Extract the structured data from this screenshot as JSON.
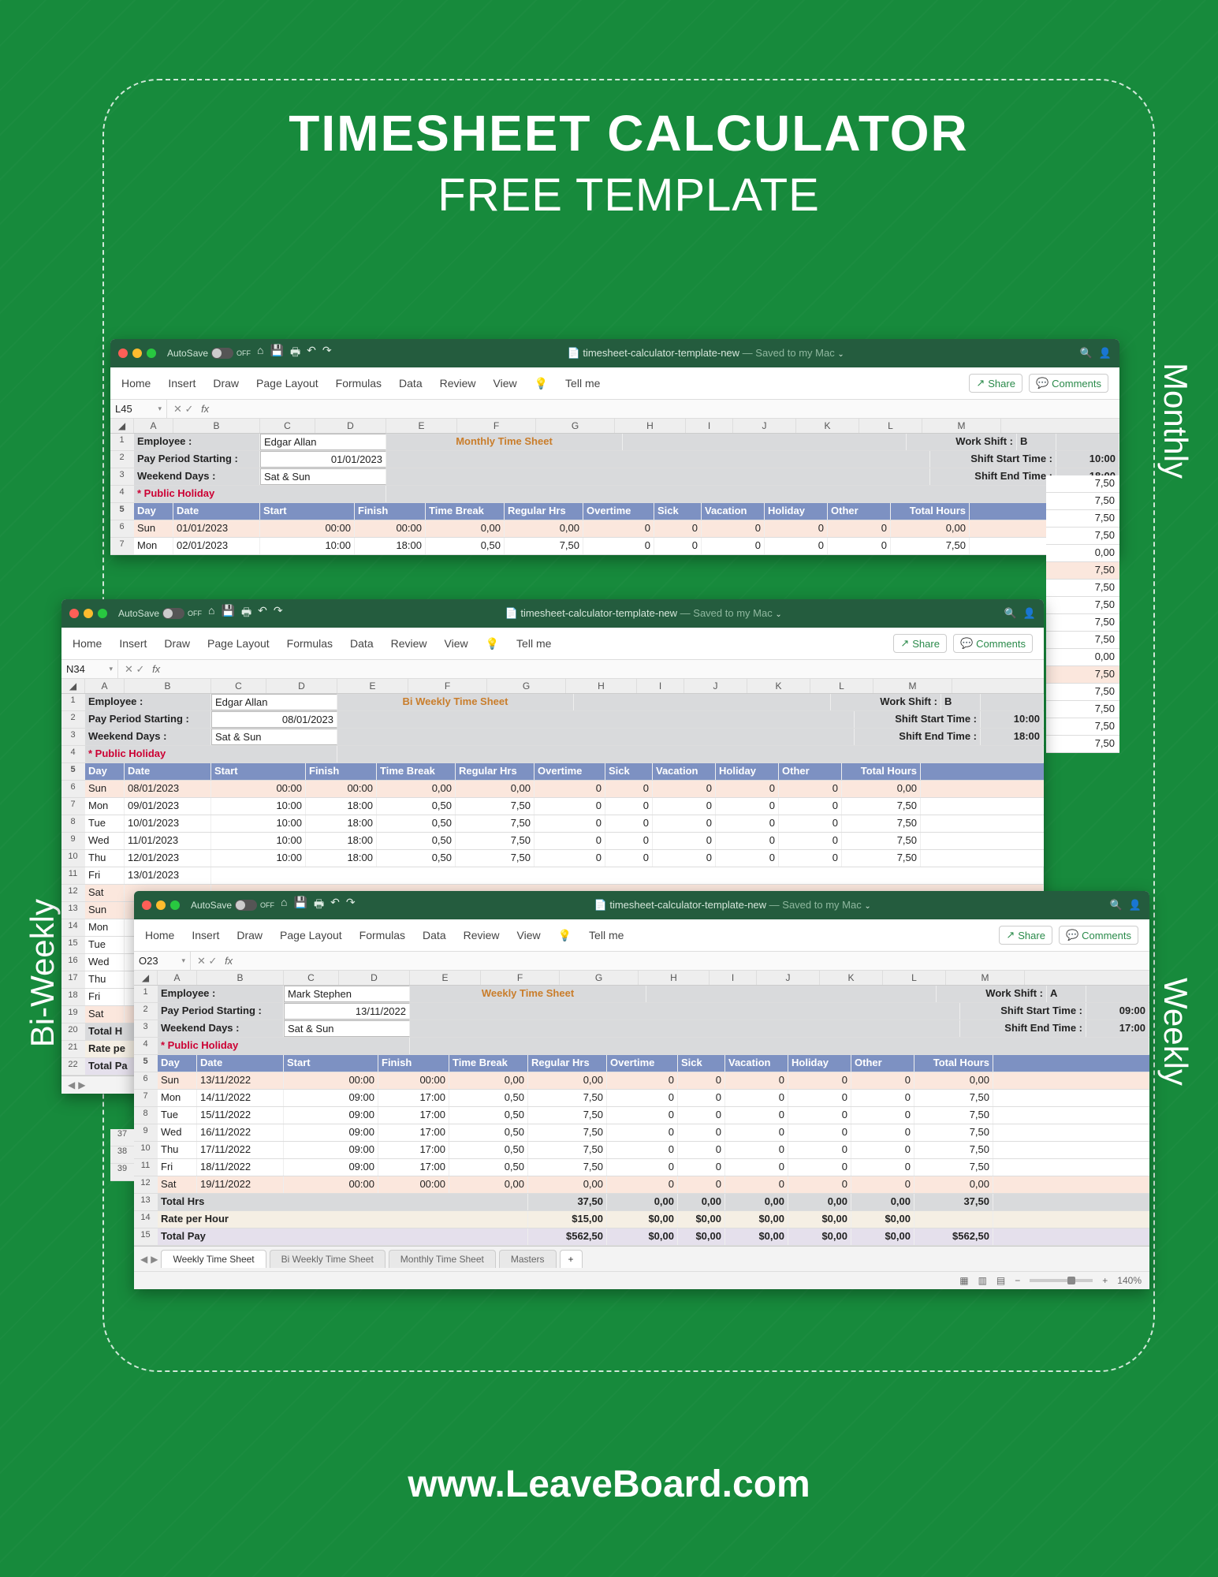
{
  "title1": "TIMESHEET CALCULATOR",
  "title2": "FREE TEMPLATE",
  "footer": "www.LeaveBoard.com",
  "side_labels": {
    "monthly": "Monthly",
    "weekly": "Weekly",
    "biweekly": "Bi-Weekly"
  },
  "ribbon_tabs": [
    "Home",
    "Insert",
    "Draw",
    "Page Layout",
    "Formulas",
    "Data",
    "Review",
    "View"
  ],
  "tellme": "Tell me",
  "share_btn": "Share",
  "comments_btn": "Comments",
  "autosave": "AutoSave",
  "autosave_state": "OFF",
  "doc": {
    "icon": "📄",
    "name": "timesheet-calculator-template-new",
    "status": "— Saved to my Mac"
  },
  "columns": [
    "A",
    "B",
    "C",
    "D",
    "E",
    "F",
    "G",
    "H",
    "I",
    "J",
    "K",
    "L",
    "M"
  ],
  "col_headers": [
    "Day",
    "Date",
    "Start",
    "Finish",
    "Time Break",
    "Regular Hrs",
    "Overtime",
    "Sick",
    "Vacation",
    "Holiday",
    "Other",
    "Total Hours"
  ],
  "info_labels": {
    "employee": "Employee :",
    "payperiod": "Pay Period Starting :",
    "weekend": "Weekend Days :",
    "holiday": "* Public Holiday",
    "workshift": "Work Shift :",
    "shiftstart": "Shift Start Time :",
    "shiftend": "Shift End Time :"
  },
  "summary_labels": {
    "totalhrs": "Total  Hrs",
    "rate": "Rate per Hour",
    "totalpay": "Total Pay",
    "totalpartial": "Total Pa"
  },
  "monthly": {
    "namebox": "L45",
    "sheet_title": "Monthly Time Sheet",
    "employee": "Edgar Allan",
    "period": "01/01/2023",
    "weekend": "Sat & Sun",
    "shift": "B",
    "shift_start": "10:00",
    "shift_end": "18:00",
    "rows": [
      {
        "n": 6,
        "day": "Sun",
        "date": "01/01/2023",
        "start": "00:00",
        "finish": "00:00",
        "break": "0,00",
        "reg": "0,00",
        "ot": "0",
        "sick": "0",
        "vac": "0",
        "hol": "0",
        "oth": "0",
        "tot": "0,00"
      },
      {
        "n": 7,
        "day": "Mon",
        "date": "02/01/2023",
        "start": "10:00",
        "finish": "18:00",
        "break": "0,50",
        "reg": "7,50",
        "ot": "0",
        "sick": "0",
        "vac": "0",
        "hol": "0",
        "oth": "0",
        "tot": "7,50"
      }
    ],
    "extras": [
      "7,50",
      "7,50",
      "7,50",
      "7,50",
      "0,00",
      "7,50",
      "7,50",
      "7,50",
      "7,50",
      "7,50",
      "0,00",
      "7,50",
      "7,50",
      "7,50",
      "7,50",
      "7,50"
    ]
  },
  "biweekly": {
    "namebox": "N34",
    "sheet_title": "Bi Weekly Time Sheet",
    "employee": "Edgar Allan",
    "period": "08/01/2023",
    "weekend": "Sat & Sun",
    "shift": "B",
    "shift_start": "10:00",
    "shift_end": "18:00",
    "rows": [
      {
        "n": 6,
        "day": "Sun",
        "date": "08/01/2023",
        "start": "00:00",
        "finish": "00:00",
        "break": "0,00",
        "reg": "0,00",
        "ot": "0",
        "sick": "0",
        "vac": "0",
        "hol": "0",
        "oth": "0",
        "tot": "0,00"
      },
      {
        "n": 7,
        "day": "Mon",
        "date": "09/01/2023",
        "start": "10:00",
        "finish": "18:00",
        "break": "0,50",
        "reg": "7,50",
        "ot": "0",
        "sick": "0",
        "vac": "0",
        "hol": "0",
        "oth": "0",
        "tot": "7,50"
      },
      {
        "n": 8,
        "day": "Tue",
        "date": "10/01/2023",
        "start": "10:00",
        "finish": "18:00",
        "break": "0,50",
        "reg": "7,50",
        "ot": "0",
        "sick": "0",
        "vac": "0",
        "hol": "0",
        "oth": "0",
        "tot": "7,50"
      },
      {
        "n": 9,
        "day": "Wed",
        "date": "11/01/2023",
        "start": "10:00",
        "finish": "18:00",
        "break": "0,50",
        "reg": "7,50",
        "ot": "0",
        "sick": "0",
        "vac": "0",
        "hol": "0",
        "oth": "0",
        "tot": "7,50"
      },
      {
        "n": 10,
        "day": "Thu",
        "date": "12/01/2023",
        "start": "10:00",
        "finish": "18:00",
        "break": "0,50",
        "reg": "7,50",
        "ot": "0",
        "sick": "0",
        "vac": "0",
        "hol": "0",
        "oth": "0",
        "tot": "7,50"
      }
    ],
    "partial_rows": [
      {
        "n": 11,
        "day": "Fri",
        "date": "13/01/2023"
      },
      {
        "n": 12,
        "day": "Sat"
      },
      {
        "n": 13,
        "day": "Sun"
      },
      {
        "n": 14,
        "day": "Mon"
      },
      {
        "n": 15,
        "day": "Tue"
      },
      {
        "n": 16,
        "day": "Wed"
      },
      {
        "n": 17,
        "day": "Thu"
      },
      {
        "n": 18,
        "day": "Fri"
      },
      {
        "n": 19,
        "day": "Sat"
      }
    ],
    "summary_rows": [
      {
        "n": 20,
        "label": "Total  H"
      },
      {
        "n": 21,
        "label": "Rate pe"
      },
      {
        "n": 22,
        "label": "Total Pa"
      }
    ]
  },
  "weekly": {
    "namebox": "O23",
    "sheet_title": "Weekly Time Sheet",
    "employee": "Mark Stephen",
    "period": "13/11/2022",
    "weekend": "Sat & Sun",
    "shift": "A",
    "shift_start": "09:00",
    "shift_end": "17:00",
    "rows": [
      {
        "n": 6,
        "day": "Sun",
        "date": "13/11/2022",
        "start": "00:00",
        "finish": "00:00",
        "break": "0,00",
        "reg": "0,00",
        "ot": "0",
        "sick": "0",
        "vac": "0",
        "hol": "0",
        "oth": "0",
        "tot": "0,00"
      },
      {
        "n": 7,
        "day": "Mon",
        "date": "14/11/2022",
        "start": "09:00",
        "finish": "17:00",
        "break": "0,50",
        "reg": "7,50",
        "ot": "0",
        "sick": "0",
        "vac": "0",
        "hol": "0",
        "oth": "0",
        "tot": "7,50"
      },
      {
        "n": 8,
        "day": "Tue",
        "date": "15/11/2022",
        "start": "09:00",
        "finish": "17:00",
        "break": "0,50",
        "reg": "7,50",
        "ot": "0",
        "sick": "0",
        "vac": "0",
        "hol": "0",
        "oth": "0",
        "tot": "7,50"
      },
      {
        "n": 9,
        "day": "Wed",
        "date": "16/11/2022",
        "start": "09:00",
        "finish": "17:00",
        "break": "0,50",
        "reg": "7,50",
        "ot": "0",
        "sick": "0",
        "vac": "0",
        "hol": "0",
        "oth": "0",
        "tot": "7,50"
      },
      {
        "n": 10,
        "day": "Thu",
        "date": "17/11/2022",
        "start": "09:00",
        "finish": "17:00",
        "break": "0,50",
        "reg": "7,50",
        "ot": "0",
        "sick": "0",
        "vac": "0",
        "hol": "0",
        "oth": "0",
        "tot": "7,50"
      },
      {
        "n": 11,
        "day": "Fri",
        "date": "18/11/2022",
        "start": "09:00",
        "finish": "17:00",
        "break": "0,50",
        "reg": "7,50",
        "ot": "0",
        "sick": "0",
        "vac": "0",
        "hol": "0",
        "oth": "0",
        "tot": "7,50"
      },
      {
        "n": 12,
        "day": "Sat",
        "date": "19/11/2022",
        "start": "00:00",
        "finish": "00:00",
        "break": "0,00",
        "reg": "0,00",
        "ot": "0",
        "sick": "0",
        "vac": "0",
        "hol": "0",
        "oth": "0",
        "tot": "0,00"
      }
    ],
    "totals": {
      "reg": "37,50",
      "ot": "0,00",
      "sick": "0,00",
      "vac": "0,00",
      "hol": "0,00",
      "oth": "0,00",
      "tot": "37,50"
    },
    "rate_row": {
      "reg": "$15,00",
      "ot": "$0,00",
      "sick": "$0,00",
      "vac": "$0,00",
      "hol": "$0,00",
      "oth": "$0,00"
    },
    "pay_row": {
      "reg": "$562,50",
      "ot": "$0,00",
      "sick": "$0,00",
      "vac": "$0,00",
      "hol": "$0,00",
      "oth": "$0,00",
      "tot": "$562,50"
    },
    "sheet_tabs": [
      "Weekly Time Sheet",
      "Bi Weekly Time Sheet",
      "Monthly Time Sheet",
      "Masters"
    ],
    "zoom": "140%"
  },
  "extra_col": [
    "37",
    "38",
    "39"
  ]
}
